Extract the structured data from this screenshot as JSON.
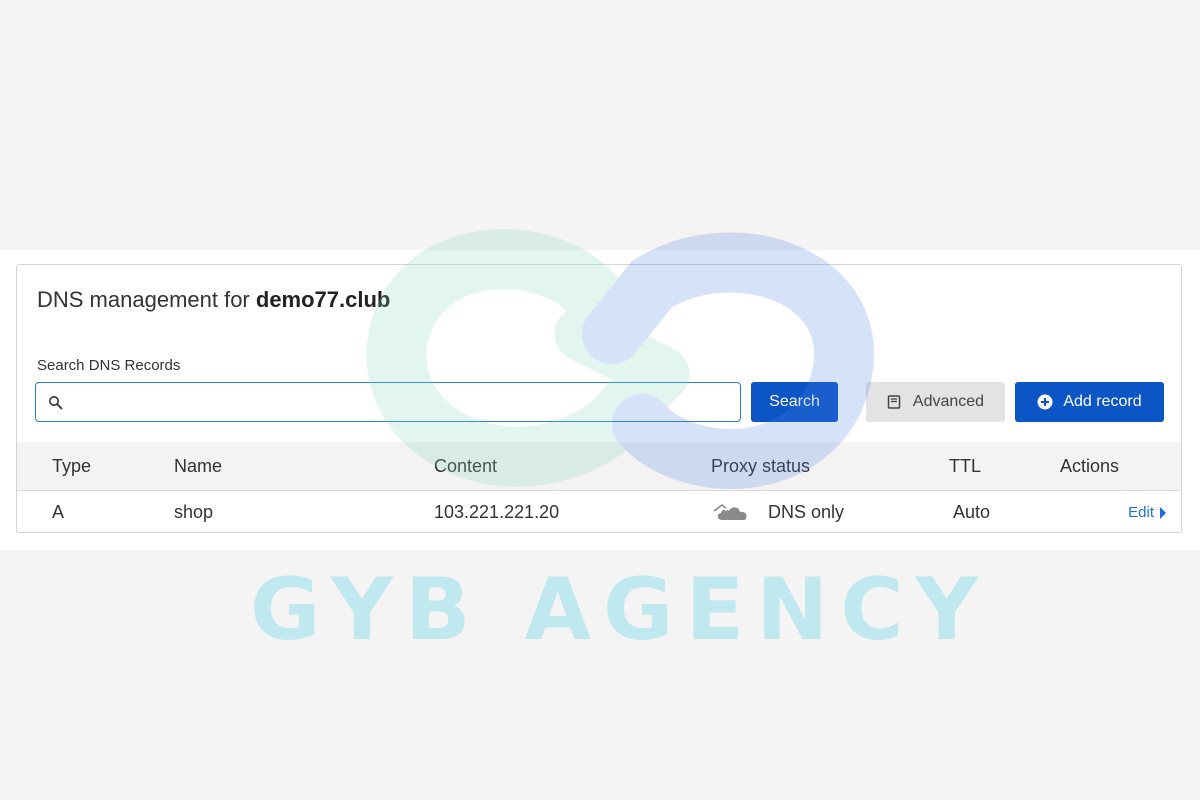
{
  "page": {
    "title_prefix": "DNS management for ",
    "domain": "demo77.club"
  },
  "search": {
    "label": "Search DNS Records",
    "value": "",
    "placeholder": "",
    "search_button": "Search",
    "advanced_button": "Advanced",
    "add_button": "Add record"
  },
  "table": {
    "headers": {
      "type": "Type",
      "name": "Name",
      "content": "Content",
      "proxy": "Proxy status",
      "ttl": "TTL",
      "actions": "Actions"
    },
    "rows": [
      {
        "type": "A",
        "name": "shop",
        "content": "103.221.221.20",
        "proxy": "DNS only",
        "ttl": "Auto",
        "action": "Edit"
      }
    ]
  },
  "watermark": {
    "text": "GYB AGENCY"
  },
  "icons": {
    "search": "search-icon",
    "advanced": "document-icon",
    "add": "plus-circle-icon",
    "proxy": "cloud-icon",
    "edit_arrow": "caret-right-icon",
    "logo": "gyb-logo-icon"
  },
  "colors": {
    "primary": "#0b55c7",
    "link": "#1a6fd6",
    "input_border": "#2c7cd6",
    "watermark_green": "#7ed6b5",
    "watermark_blue": "#4a7fe0",
    "watermark_text": "#bfe8ef"
  }
}
